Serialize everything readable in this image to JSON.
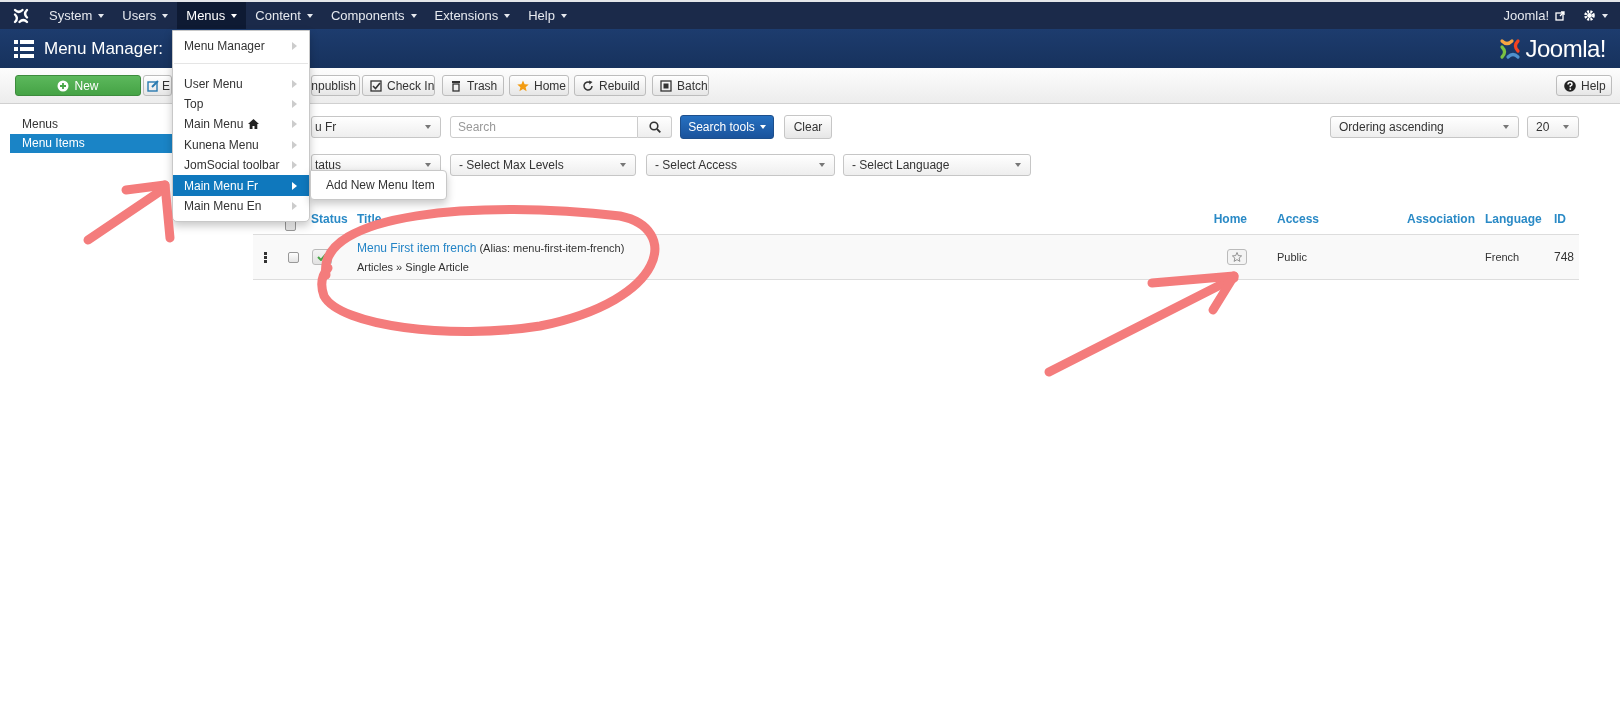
{
  "top_nav": {
    "items": [
      {
        "label": "System",
        "selected": false
      },
      {
        "label": "Users",
        "selected": false
      },
      {
        "label": "Menus",
        "selected": true
      },
      {
        "label": "Content",
        "selected": false
      },
      {
        "label": "Components",
        "selected": false
      },
      {
        "label": "Extensions",
        "selected": false
      },
      {
        "label": "Help",
        "selected": false
      }
    ],
    "site_link": "Joomla!"
  },
  "header": {
    "title": "Menu Manager:",
    "logo_text": "Joomla!"
  },
  "toolbar": {
    "buttons": [
      {
        "kind": "new",
        "label": "New"
      },
      {
        "kind": "edit",
        "label": "E"
      },
      {
        "kind": "unpublish",
        "label": "npublish"
      },
      {
        "kind": "checkin",
        "label": "Check In"
      },
      {
        "kind": "trash",
        "label": "Trash"
      },
      {
        "kind": "home",
        "label": "Home"
      },
      {
        "kind": "rebuild",
        "label": "Rebuild"
      },
      {
        "kind": "batch",
        "label": "Batch"
      }
    ],
    "help": "Help"
  },
  "sidebar": {
    "items": [
      {
        "label": "Menus",
        "selected": false
      },
      {
        "label": "Menu Items",
        "selected": true
      }
    ]
  },
  "filters": {
    "menu_select": "u Fr",
    "search": {
      "placeholder": "Search"
    },
    "search_tools": "Search tools",
    "clear": "Clear",
    "ordering": "Ordering ascending",
    "limit": "20",
    "selects": [
      "tatus",
      "- Select Max Levels",
      "- Select Access",
      "- Select Language"
    ]
  },
  "table": {
    "all_checked": false,
    "columns": [
      "Status",
      "Title",
      "Home",
      "Access",
      "Association",
      "Language",
      "ID"
    ],
    "rows": [
      {
        "checked": false,
        "published": true,
        "title": "Menu First item french",
        "alias": "(Alias: menu-first-item-french)",
        "type": "Articles » Single Article",
        "home": false,
        "access": "Public",
        "association": "",
        "language": "French",
        "id": "748"
      }
    ]
  },
  "menus_dropdown": {
    "items": [
      {
        "kind": "item",
        "label": "Menu Manager",
        "selected": false,
        "home": false
      },
      {
        "kind": "divider"
      },
      {
        "kind": "item",
        "label": "User Menu",
        "selected": false,
        "home": false
      },
      {
        "kind": "item",
        "label": "Top",
        "selected": false,
        "home": false
      },
      {
        "kind": "item",
        "label": "Main Menu",
        "selected": false,
        "home": true
      },
      {
        "kind": "item",
        "label": "Kunena Menu",
        "selected": false,
        "home": false
      },
      {
        "kind": "item",
        "label": "JomSocial toolbar",
        "selected": false,
        "home": false
      },
      {
        "kind": "item",
        "label": "Main Menu Fr",
        "selected": true,
        "home": false
      },
      {
        "kind": "item",
        "label": "Main Menu En",
        "selected": false,
        "home": false
      }
    ],
    "submenu": [
      "Add New Menu Item"
    ]
  }
}
